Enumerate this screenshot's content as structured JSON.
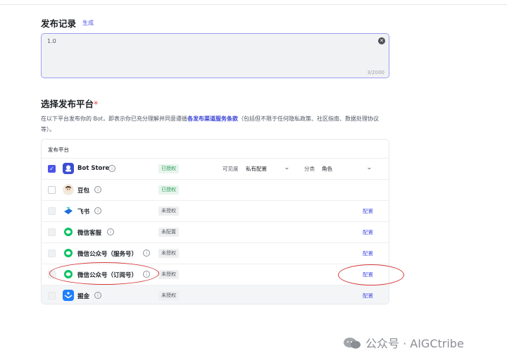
{
  "release": {
    "title": "发布记录",
    "generate_label": "生成",
    "textarea_value": "1.0",
    "counter": "3/2000"
  },
  "platforms": {
    "title": "选择发布平台",
    "required_mark": "*",
    "desc_pre": "在以下平台发布你的 Bot，即表示你已充分理解并同意遵循",
    "desc_link": "各发布渠道服务条款",
    "desc_post": "（包括但不限于任何隐私政策、社区指南、数据处理协议等）。",
    "column_header": "发布平台",
    "visibility_label": "可见度",
    "visibility_value": "私有配置",
    "category_label": "分类",
    "category_value": "角色",
    "config_label": "配置",
    "rows": [
      {
        "name": "Bot Store",
        "status": "已授权",
        "checked": true
      },
      {
        "name": "豆包",
        "status": "已授权",
        "checked": false
      },
      {
        "name": "飞书",
        "status": "未授权",
        "checked": false
      },
      {
        "name": "微信客服",
        "status": "未配置",
        "checked": false
      },
      {
        "name": "微信公众号（服务号）",
        "status": "未授权",
        "checked": false
      },
      {
        "name": "微信公众号（订阅号）",
        "status": "未授权",
        "checked": false
      },
      {
        "name": "掘金",
        "status": "未授权",
        "checked": false
      }
    ]
  },
  "watermark": "公众号 · AIGCtribe",
  "colors": {
    "accent": "#4d53e8",
    "authorized_tag": "#2f9a5b",
    "annotation": "#d43b3b",
    "wechat": "#07c160"
  }
}
